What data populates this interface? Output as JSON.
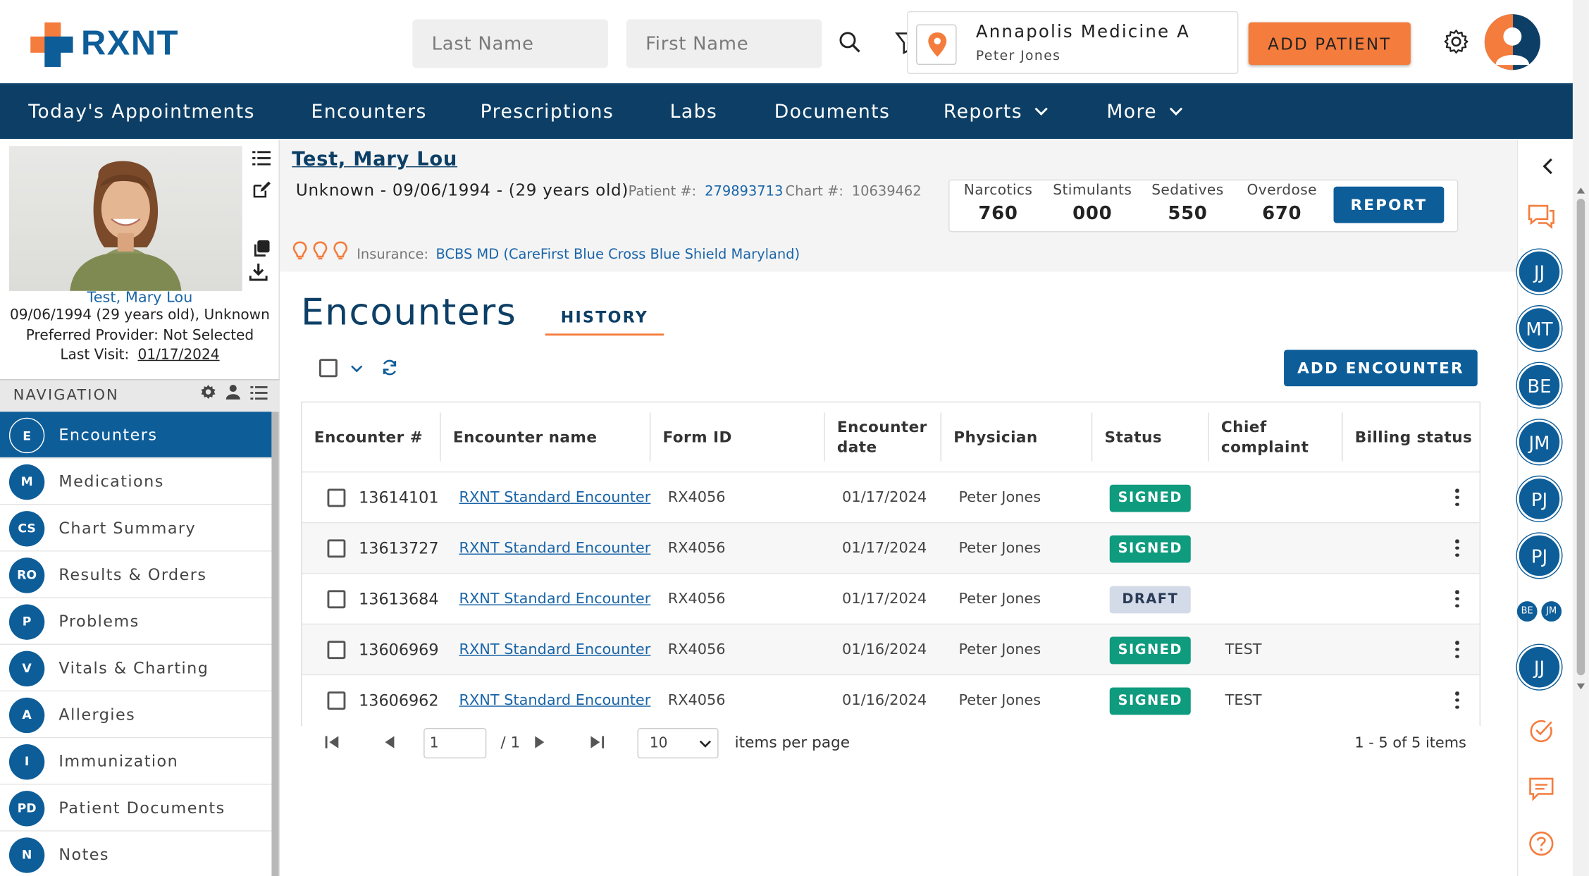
{
  "header": {
    "logo_text": "RXNT",
    "last_name_placeholder": "Last Name",
    "first_name_placeholder": "First Name",
    "location_name": "Annapolis Medicine A",
    "location_user": "Peter Jones",
    "add_patient_label": "ADD PATIENT"
  },
  "nav": {
    "items": [
      "Today's Appointments",
      "Encounters",
      "Prescriptions",
      "Labs",
      "Documents",
      "Reports",
      "More"
    ]
  },
  "patient": {
    "name": "Test, Mary Lou",
    "demographics": "Unknown - 09/06/1994 - (29 years old)",
    "patient_num_label": "Patient #:",
    "patient_num": "279893713",
    "chart_num_label": "Chart #:",
    "chart_num": "10639462",
    "insurance_label": "Insurance:",
    "insurance": "BCBS MD (CareFirst Blue Cross Blue Shield Maryland)",
    "card_name": "Test, Mary Lou",
    "card_dob": "09/06/1994 (29 years old), Unknown",
    "card_provider": "Preferred Provider: Not Selected",
    "card_last_visit_label": "Last Visit:",
    "card_last_visit": "01/17/2024"
  },
  "pdmp": {
    "items": [
      {
        "label": "Narcotics",
        "value": "760"
      },
      {
        "label": "Stimulants",
        "value": "000"
      },
      {
        "label": "Sedatives",
        "value": "550"
      },
      {
        "label": "Overdose",
        "value": "670"
      }
    ],
    "report_label": "REPORT"
  },
  "sidebar": {
    "heading": "NAVIGATION",
    "items": [
      {
        "badge": "E",
        "label": "Encounters"
      },
      {
        "badge": "M",
        "label": "Medications"
      },
      {
        "badge": "CS",
        "label": "Chart Summary"
      },
      {
        "badge": "RO",
        "label": "Results & Orders"
      },
      {
        "badge": "P",
        "label": "Problems"
      },
      {
        "badge": "V",
        "label": "Vitals & Charting"
      },
      {
        "badge": "A",
        "label": "Allergies"
      },
      {
        "badge": "I",
        "label": "Immunization"
      },
      {
        "badge": "PD",
        "label": "Patient Documents"
      },
      {
        "badge": "N",
        "label": "Notes"
      }
    ]
  },
  "main": {
    "title": "Encounters",
    "history_tab": "HISTORY",
    "add_encounter_label": "ADD ENCOUNTER",
    "columns": [
      "Encounter #",
      "Encounter name",
      "Form ID",
      "Encounter date",
      "Physician",
      "Status",
      "Chief complaint",
      "Billing status"
    ],
    "rows": [
      {
        "enc": "13614101",
        "name": "RXNT Standard Encounter",
        "form": "RX4056",
        "date": "01/17/2024",
        "physician": "Peter Jones",
        "status": "SIGNED",
        "complaint": ""
      },
      {
        "enc": "13613727",
        "name": "RXNT Standard Encounter",
        "form": "RX4056",
        "date": "01/17/2024",
        "physician": "Peter Jones",
        "status": "SIGNED",
        "complaint": ""
      },
      {
        "enc": "13613684",
        "name": "RXNT Standard Encounter",
        "form": "RX4056",
        "date": "01/17/2024",
        "physician": "Peter Jones",
        "status": "DRAFT",
        "complaint": ""
      },
      {
        "enc": "13606969",
        "name": "RXNT Standard Encounter",
        "form": "RX4056",
        "date": "01/16/2024",
        "physician": "Peter Jones",
        "status": "SIGNED",
        "complaint": "TEST"
      },
      {
        "enc": "13606962",
        "name": "RXNT Standard Encounter",
        "form": "RX4056",
        "date": "01/16/2024",
        "physician": "Peter Jones",
        "status": "SIGNED",
        "complaint": "TEST"
      }
    ],
    "pager": {
      "page": "1",
      "of_pages": "/ 1",
      "per_page": "10",
      "per_page_label": "items per page",
      "summary": "1 - 5 of 5 items"
    }
  },
  "rail": {
    "avatars": [
      "JJ",
      "MT",
      "BE",
      "JM",
      "PJ",
      "PJ"
    ],
    "mini_avatars": [
      "BE",
      "JM"
    ],
    "last_avatar": "JJ"
  },
  "colors": {
    "nav_bg": "#0d3f66",
    "primary": "#0d5d99",
    "accent_orange": "#f47c3c",
    "signed": "#0f9b7e"
  }
}
